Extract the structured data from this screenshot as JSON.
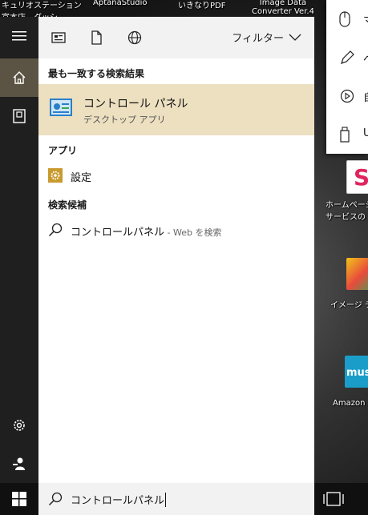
{
  "desktop": {
    "top_labels": [
      {
        "line1": "キュリオステーション",
        "line2": "富本店 - ダッシ"
      },
      {
        "line1": "AptanaStudio",
        "line2": ""
      },
      {
        "line1": "いきなりPDF",
        "line2": ""
      },
      {
        "line1": "Image Data",
        "line2": "Converter Ver.4"
      }
    ],
    "icons": [
      {
        "label1": "ホームページ",
        "label2": "サービスの",
        "color": "#e0245e"
      },
      {
        "label1": "イメージ デ",
        "label2": "",
        "color": "#f0c419"
      },
      {
        "label1": "Amazon",
        "label2": "",
        "color": "#1a9ec9",
        "badge": "mus"
      }
    ]
  },
  "rail": {
    "items": [
      "menu-icon",
      "home-icon",
      "notebook-icon",
      "settings-icon",
      "user-icon"
    ]
  },
  "toolbar": {
    "filter_label": "フィルター"
  },
  "results": {
    "best_match_header": "最も一致する検索結果",
    "best_match": {
      "title": "コントロール パネル",
      "subtitle": "デスクトップ アプリ"
    },
    "apps_header": "アプリ",
    "apps": [
      {
        "label": "設定"
      }
    ],
    "suggestions_header": "検索候補",
    "suggestions": [
      {
        "label": "コントロールパネル",
        "sub": " - Web を検索"
      }
    ]
  },
  "search": {
    "query": "コントロールパネル"
  },
  "flyout": {
    "items": [
      {
        "icon": "mouse-icon",
        "text": "マ"
      },
      {
        "icon": "pen-icon",
        "text": "ペ"
      },
      {
        "icon": "autoplay-icon",
        "text": "自"
      },
      {
        "icon": "usb-icon",
        "text": "U"
      }
    ]
  },
  "colors": {
    "accent_selected": "#ece0c0",
    "rail_active": "#5b5343"
  }
}
